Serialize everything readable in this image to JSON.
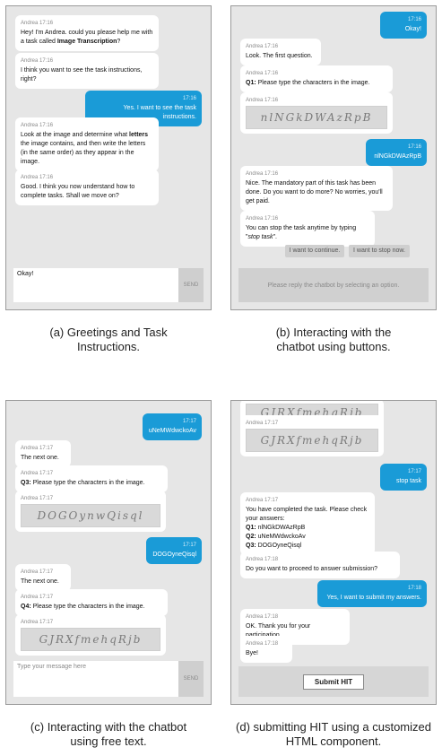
{
  "panel_a": {
    "messages": [
      {
        "meta": "Andrea 17:16",
        "pre": "Hey! I'm Andrea. could you please help me with a task called ",
        "bold": "Image Transcription",
        "post": "?"
      },
      {
        "meta": "Andrea 17:16",
        "text": "I think you want to see the task instructions, right?"
      },
      {
        "meta": "17:16",
        "text": "Yes. I want to see the task instructions."
      },
      {
        "meta": "Andrea 17:16",
        "pre": "Look at the image and determine what ",
        "bold": "letters",
        "post": " the image contains, and then write the letters (in the same order) as they appear in the image."
      },
      {
        "meta": "Andrea 17:16",
        "text": "Good. I think you now understand how to complete tasks. Shall we move on?"
      }
    ],
    "input_value": "Okay!",
    "send_label": "SEND",
    "caption": "(a) Greetings and Task Instructions."
  },
  "panel_b": {
    "messages": [
      {
        "meta": "17:16",
        "text": "Okay!"
      },
      {
        "meta": "Andrea 17:16",
        "text": "Look. The first question."
      },
      {
        "meta": "Andrea 17:16",
        "qlabel": "Q1:",
        "text": " Please type the characters in the image."
      },
      {
        "meta": "Andrea 17:16",
        "captcha": "nlNGkDWAzRpB"
      },
      {
        "meta": "17:16",
        "text": "nlNGkDWAzRpB"
      },
      {
        "meta": "Andrea 17:16",
        "text": "Nice. The mandatory part of this task has been done. Do you want to do more? No worries, you'll get paid."
      },
      {
        "meta": "Andrea 17:16",
        "pre": "You can stop the task anytime by typing \"",
        "italic": "stop task",
        "post": "\"."
      }
    ],
    "option_continue": "I want to continue.",
    "option_stop": "I want to stop now.",
    "reply_hint": "Please reply the chatbot by selecting an option.",
    "caption": "(b) Interacting with the chatbot using buttons."
  },
  "panel_c": {
    "messages": [
      {
        "meta": "17:17",
        "text": "uNeMWdwckoAv"
      },
      {
        "meta": "Andrea 17:17",
        "text": "The next one."
      },
      {
        "meta": "Andrea 17:17",
        "qlabel": "Q3:",
        "text": " Please type the characters in the image."
      },
      {
        "meta": "Andrea 17:17",
        "captcha": "DOGOynwQisql"
      },
      {
        "meta": "17:17",
        "text": "DOGOyneQisql"
      },
      {
        "meta": "Andrea 17:17",
        "text": "The next one."
      },
      {
        "meta": "Andrea 17:17",
        "qlabel": "Q4:",
        "text": " Please type the characters in the image."
      },
      {
        "meta": "Andrea 17:17",
        "captcha": "GJRXfmehqRjb"
      }
    ],
    "input_placeholder": "Type your message here",
    "send_label": "SEND",
    "caption": "(c) Interacting with the chatbot using free text."
  },
  "panel_d": {
    "messages": [
      {
        "meta": "Andrea 17:17",
        "captcha": "GJRXfmehqRjb"
      },
      {
        "meta": "17:17",
        "text": "stop task"
      },
      {
        "meta": "Andrea 17:17",
        "text": "You have completed the task. Please check your answers:"
      },
      {
        "meta": "Andrea 17:18",
        "text": "Do you want to proceed to answer submission?"
      },
      {
        "meta": "17:18",
        "text": "Yes, I want to submit my answers."
      },
      {
        "meta": "Andrea 17:18",
        "text": "OK. Thank you for your participation."
      },
      {
        "meta": "Andrea 17:18",
        "text": "Bye!"
      }
    ],
    "answers": [
      {
        "label": "Q1:",
        "value": "nlNGkDWAzRpB"
      },
      {
        "label": "Q2:",
        "value": "uNeMWdwckoAv"
      },
      {
        "label": "Q3:",
        "value": "DOGOyneQisql"
      }
    ],
    "submit_label": "Submit HIT",
    "caption": "(d) submitting HIT using a customized HTML component."
  },
  "colors": {
    "user_bubble": "#1a9bd7",
    "panel_bg": "#e6e6e6",
    "bot_bubble": "#ffffff"
  }
}
